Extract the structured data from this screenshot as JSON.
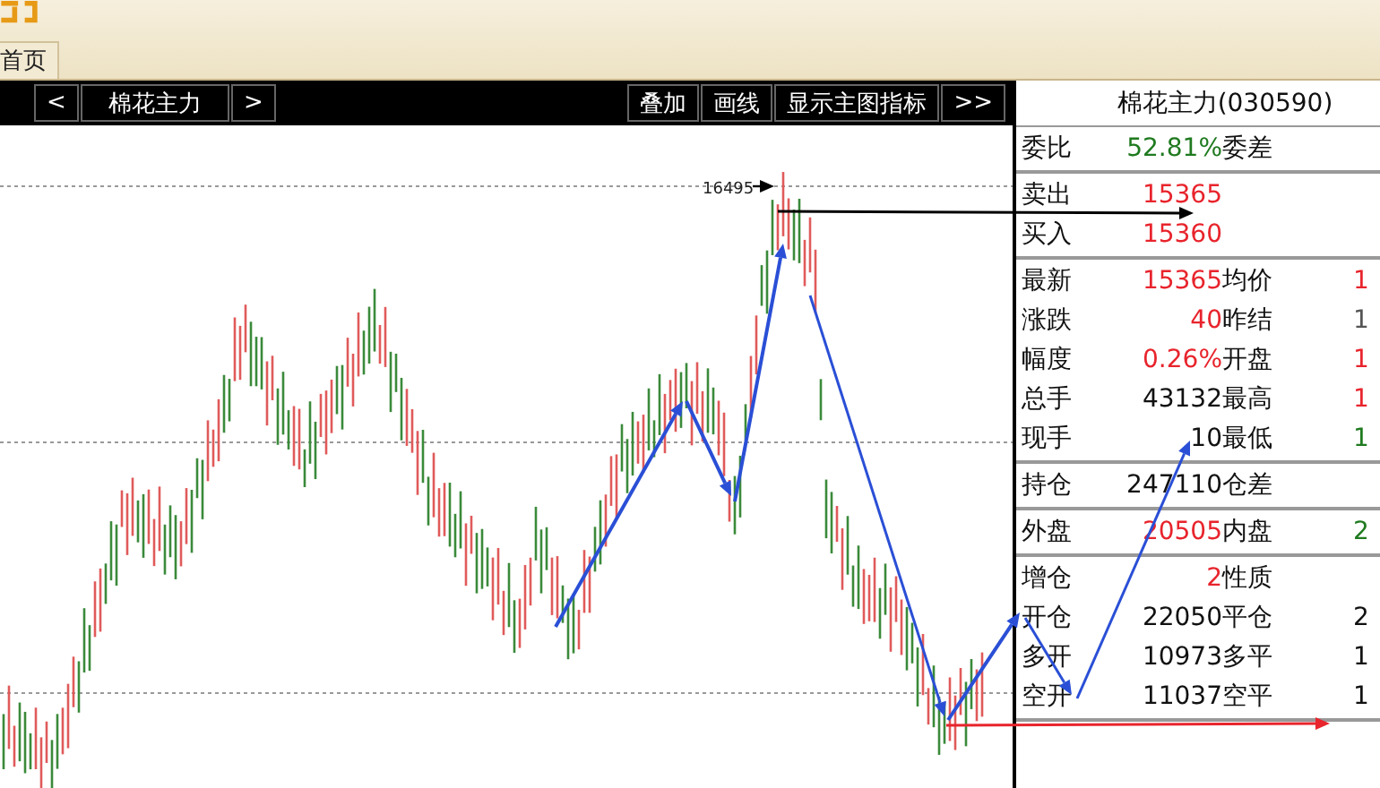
{
  "top_tabs": [
    {
      "label": "首页",
      "selected": true
    }
  ],
  "toolbar": {
    "prev": "<",
    "symbol": "棉花主力",
    "next": ">",
    "buttons": [
      "叠加",
      "画线",
      "显示主图指标",
      ">>"
    ]
  },
  "chart": {
    "high_label": "16495"
  },
  "quote": {
    "title": "棉花主力(030590)",
    "sections": [
      [
        {
          "cells": [
            {
              "kind": "label",
              "text": "委比"
            },
            {
              "kind": "value",
              "text": "52.81%",
              "color": "#1f7a1f"
            },
            {
              "kind": "label",
              "text": "委差"
            }
          ]
        }
      ],
      [
        {
          "cells": [
            {
              "kind": "label",
              "text": "卖出"
            },
            {
              "kind": "value",
              "text": "15365",
              "color": "#e8242c"
            }
          ]
        },
        {
          "cells": [
            {
              "kind": "label",
              "text": "买入"
            },
            {
              "kind": "value",
              "text": "15360",
              "color": "#e8242c"
            }
          ]
        }
      ],
      [
        {
          "cells": [
            {
              "kind": "label",
              "text": "最新"
            },
            {
              "kind": "value",
              "text": "15365",
              "color": "#e8242c"
            },
            {
              "kind": "label",
              "text": "均价"
            },
            {
              "kind": "value",
              "text": "1",
              "color": "#e8242c"
            }
          ]
        },
        {
          "cells": [
            {
              "kind": "label",
              "text": "涨跌"
            },
            {
              "kind": "value",
              "text": "40",
              "color": "#e8242c"
            },
            {
              "kind": "label",
              "text": "昨结"
            },
            {
              "kind": "value",
              "text": "1",
              "color": "#555555"
            }
          ]
        },
        {
          "cells": [
            {
              "kind": "label",
              "text": "幅度"
            },
            {
              "kind": "value",
              "text": "0.26%",
              "color": "#e8242c"
            },
            {
              "kind": "label",
              "text": "开盘"
            },
            {
              "kind": "value",
              "text": "1",
              "color": "#e8242c"
            }
          ]
        },
        {
          "cells": [
            {
              "kind": "label",
              "text": "总手"
            },
            {
              "kind": "value",
              "text": "43132",
              "color": "#111111"
            },
            {
              "kind": "label",
              "text": "最高"
            },
            {
              "kind": "value",
              "text": "1",
              "color": "#e8242c"
            }
          ]
        },
        {
          "cells": [
            {
              "kind": "label",
              "text": "现手"
            },
            {
              "kind": "value",
              "text": "10",
              "color": "#111111"
            },
            {
              "kind": "label",
              "text": "最低"
            },
            {
              "kind": "value",
              "text": "1",
              "color": "#1f7a1f"
            }
          ]
        }
      ],
      [
        {
          "cells": [
            {
              "kind": "label",
              "text": "持仓"
            },
            {
              "kind": "value",
              "text": "247110",
              "color": "#111111"
            },
            {
              "kind": "label",
              "text": "仓差"
            }
          ]
        }
      ],
      [
        {
          "cells": [
            {
              "kind": "label",
              "text": "外盘"
            },
            {
              "kind": "value",
              "text": "20505",
              "color": "#e8242c"
            },
            {
              "kind": "label",
              "text": "内盘"
            },
            {
              "kind": "value",
              "text": "2",
              "color": "#1f7a1f"
            }
          ]
        }
      ],
      [
        {
          "cells": [
            {
              "kind": "label",
              "text": "增仓"
            },
            {
              "kind": "value",
              "text": "2",
              "color": "#e8242c"
            },
            {
              "kind": "label",
              "text": "性质"
            }
          ]
        },
        {
          "cells": [
            {
              "kind": "label",
              "text": "开仓"
            },
            {
              "kind": "value",
              "text": "22050",
              "color": "#111111"
            },
            {
              "kind": "label",
              "text": "平仓"
            },
            {
              "kind": "value",
              "text": "2",
              "color": "#111111"
            }
          ]
        },
        {
          "cells": [
            {
              "kind": "label",
              "text": "多开"
            },
            {
              "kind": "value",
              "text": "10973",
              "color": "#111111"
            },
            {
              "kind": "label",
              "text": "多平"
            },
            {
              "kind": "value",
              "text": "1",
              "color": "#111111"
            }
          ]
        },
        {
          "cells": [
            {
              "kind": "label",
              "text": "空开"
            },
            {
              "kind": "value",
              "text": "11037",
              "color": "#111111"
            },
            {
              "kind": "label",
              "text": "空平"
            },
            {
              "kind": "value",
              "text": "1",
              "color": "#111111"
            }
          ]
        }
      ]
    ]
  }
}
